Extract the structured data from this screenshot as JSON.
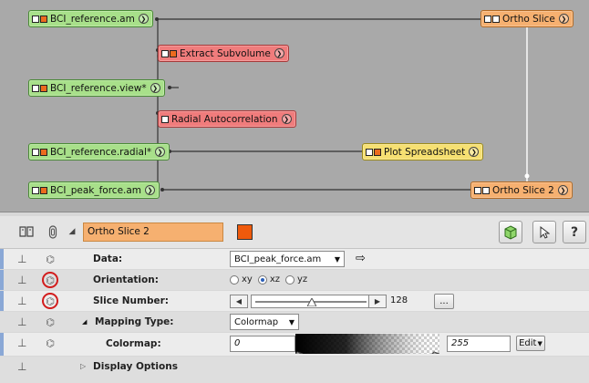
{
  "graph": {
    "nodes": [
      {
        "label": "BCI_reference.am"
      },
      {
        "label": "Extract Subvolume"
      },
      {
        "label": "BCI_reference.view*"
      },
      {
        "label": "Radial Autocorrelation"
      },
      {
        "label": "BCI_reference.radial*"
      },
      {
        "label": "Plot Spreadsheet"
      },
      {
        "label": "BCI_peak_force.am"
      },
      {
        "label": "Ortho Slice"
      },
      {
        "label": "Ortho Slice 2"
      }
    ]
  },
  "toolbar": {
    "object_name": "Ortho Slice 2",
    "object_color": "#ef5a0c",
    "collapse_glyph": "◢"
  },
  "properties": {
    "data": {
      "label": "Data:",
      "value": "BCI_peak_force.am"
    },
    "orientation": {
      "label": "Orientation:",
      "options": [
        "xy",
        "xz",
        "yz"
      ],
      "selected": "xz"
    },
    "slice_number": {
      "label": "Slice Number:",
      "value": "128",
      "more": "...",
      "fraction": 0.5
    },
    "mapping_type": {
      "label": "Mapping Type:",
      "value": "Colormap",
      "expand_glyph": "◢"
    },
    "colormap": {
      "label": "Colormap:",
      "min": "0",
      "max": "255",
      "edit": "Edit"
    },
    "display_options": {
      "label": "Display Options",
      "expand_glyph": "▷"
    }
  }
}
